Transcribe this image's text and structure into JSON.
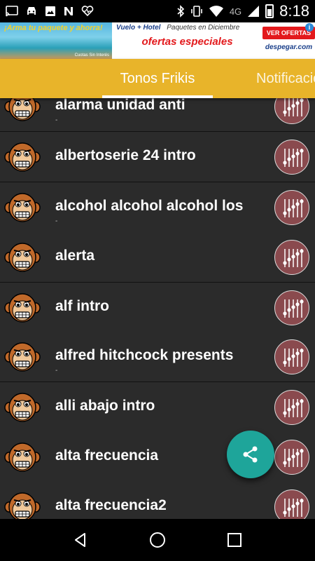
{
  "status_bar": {
    "network": "4G",
    "time": "8:18",
    "icons": [
      "cast-icon",
      "car-icon",
      "image-icon",
      "n-icon",
      "heart-monitor-icon",
      "bluetooth-icon",
      "vibrate-icon",
      "wifi-icon",
      "signal-icon",
      "battery-icon"
    ]
  },
  "ad": {
    "headline": "¡Arma tu paquete y ahorra!",
    "small_print": "Cuotas Sin Interés",
    "line1_brand": "Vuelo + Hotel",
    "line1_text": "Paquetes en Diciembre",
    "offer": "ofertas especiales",
    "button": "VER OFERTAS",
    "brand": "despegar.com",
    "info": "i"
  },
  "tabs": {
    "active": "Tonos Frikis",
    "inactive": "Notificaciones"
  },
  "list": {
    "items": [
      {
        "title": "alarma unidad anti",
        "sub": "-"
      },
      {
        "title": "albertoserie 24 intro",
        "sub": ""
      },
      {
        "title": "alcohol alcohol alcohol los",
        "sub": "-"
      },
      {
        "title": "alerta",
        "sub": ""
      },
      {
        "title": "alf intro",
        "sub": ""
      },
      {
        "title": "alfred hitchcock presents",
        "sub": "-"
      },
      {
        "title": "alli abajo intro",
        "sub": ""
      },
      {
        "title": "alta frecuencia",
        "sub": ""
      },
      {
        "title": "alta frecuencia2",
        "sub": ""
      }
    ]
  },
  "fab": {
    "icon": "share-icon"
  },
  "navbar": {
    "icons": [
      "back-icon",
      "home-icon",
      "recents-icon"
    ]
  },
  "colors": {
    "toolbar": "#e8b42a",
    "list_bg": "#2b2b2b",
    "eq_button": "#8a4a4e",
    "fab": "#1ea59a",
    "monkey": "#c0692a"
  }
}
